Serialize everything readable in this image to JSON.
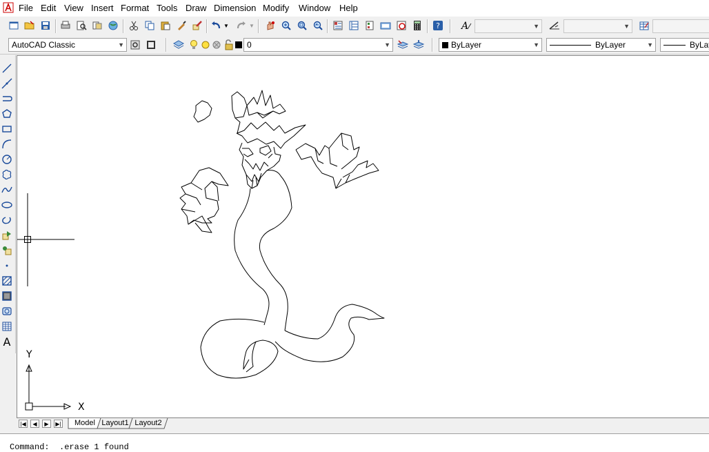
{
  "menu": [
    "File",
    "Edit",
    "View",
    "Insert",
    "Format",
    "Tools",
    "Draw",
    "Dimension",
    "Modify",
    "Window",
    "Help"
  ],
  "toolbar": {
    "workspace": "AutoCAD Classic",
    "layer": "0",
    "color": "ByLayer",
    "linetype": "ByLayer",
    "lineweight": "ByLay"
  },
  "tabs": [
    "Model",
    "Layout1",
    "Layout2"
  ],
  "ucs": {
    "x_label": "X",
    "y_label": "Y"
  },
  "command": "Command:  .erase 1 found"
}
